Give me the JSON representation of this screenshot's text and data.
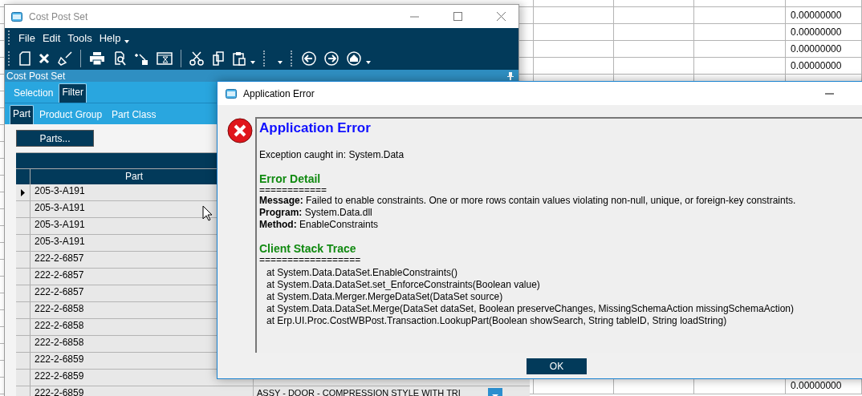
{
  "background_sheet": {
    "top_values": [
      "0.00000000",
      "0.00000000",
      "0.00000000",
      "0.00000000"
    ],
    "bottom_values": [
      "0.00000000"
    ]
  },
  "main_window": {
    "title": "Cost Post Set",
    "menu": [
      "File",
      "Edit",
      "Tools",
      "Help"
    ],
    "panel_title": "Cost Post Set",
    "tabs": [
      {
        "label": "Selection",
        "selected": false
      },
      {
        "label": "Filter",
        "selected": true
      }
    ],
    "subtabs": [
      {
        "label": "Part",
        "selected": true
      },
      {
        "label": "Product Group",
        "selected": false
      },
      {
        "label": "Part Class",
        "selected": false
      }
    ],
    "parts_button": "Parts...",
    "grid": {
      "columns": [
        "Part"
      ],
      "rows": [
        {
          "part": "205-3-A191",
          "current": true
        },
        {
          "part": "205-3-A191",
          "current": false
        },
        {
          "part": "205-3-A191",
          "current": false
        },
        {
          "part": "205-3-A191",
          "current": false
        },
        {
          "part": "222-2-6857",
          "current": false
        },
        {
          "part": "222-2-6857",
          "current": false
        },
        {
          "part": "222-2-6857",
          "current": false
        },
        {
          "part": "222-2-6858",
          "current": false
        },
        {
          "part": "222-2-6858",
          "current": false
        },
        {
          "part": "222-2-6858",
          "current": false
        },
        {
          "part": "222-2-6859",
          "current": false
        },
        {
          "part": "222-2-6859",
          "current": false
        },
        {
          "part": "222-2-6859",
          "current": false,
          "description": "ASSY - DOOR - COMPRESSION STYLE WITH TRI"
        }
      ]
    }
  },
  "dialog": {
    "title": "Application Error",
    "heading": "Application Error",
    "exception": "Exception caught in: System.Data",
    "sections": [
      {
        "title": "Error Detail",
        "rule": "============",
        "lines": [
          "**Message:** Failed to enable constraints. One or more rows contain values violating non-null, unique, or foreign-key constraints.",
          "**Program:** System.Data.dll",
          "**Method:** EnableConstraints"
        ],
        "kind": "detail"
      },
      {
        "title": "Client Stack Trace",
        "rule": "==================",
        "lines": [
          "at System.Data.DataSet.EnableConstraints()",
          "at System.Data.DataSet.set_EnforceConstraints(Boolean value)",
          "at System.Data.Merger.MergeDataSet(DataSet source)",
          "at System.Data.DataSet.Merge(DataSet dataSet, Boolean preserveChanges, MissingSchemaAction missingSchemaAction)",
          "at Erp.UI.Proc.CostWBPost.Transaction.LookupPart(Boolean showSearch, String tableID, String loadString)"
        ],
        "kind": "trace"
      }
    ],
    "ok_button": "OK"
  }
}
